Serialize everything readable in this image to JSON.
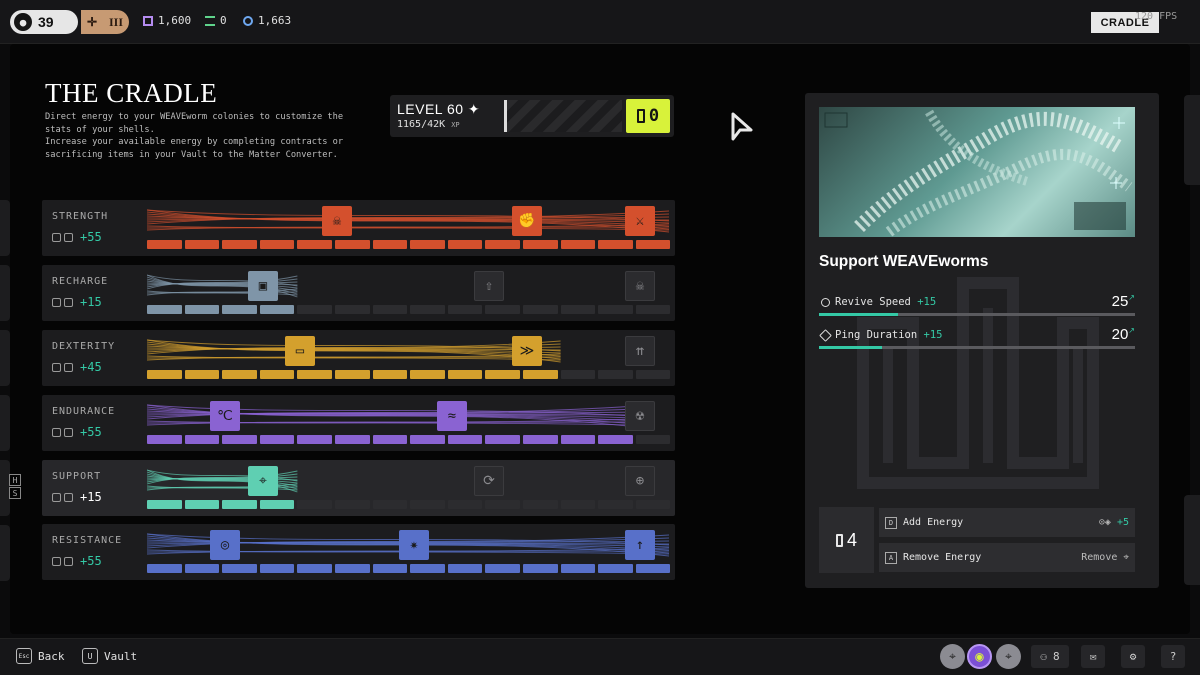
{
  "topbar": {
    "level": "39",
    "rank": "III",
    "currencies": [
      {
        "icon": "square-token-icon",
        "value": "1,600",
        "color": "#b58cf0"
      },
      {
        "icon": "stack-token-icon",
        "value": "0",
        "color": "#5fd38b"
      },
      {
        "icon": "link-token-icon",
        "value": "1,663",
        "color": "#6fa8f0"
      }
    ],
    "menu_button": "CRADLE",
    "fps": "120 FPS"
  },
  "header": {
    "title": "THE CRADLE",
    "description": [
      "Direct energy to your WEAVEworm colonies to customize the",
      "stats of your shells.",
      "Increase your available energy by completing contracts or",
      "sacrificing items in your Vault to the Matter Converter."
    ]
  },
  "level": {
    "label": "LEVEL 60 ✦",
    "xp": "1165/42K",
    "xp_unit": "XP",
    "energy": "0",
    "accent": "#d8f23a"
  },
  "stats": [
    {
      "name": "STRENGTH",
      "bonus": "+55",
      "color": "#d4502d",
      "filled": 14,
      "total": 14,
      "nodes": [
        "skull-icon",
        "fist-icon",
        "blade-icon"
      ],
      "nodes_unlocked": 3
    },
    {
      "name": "RECHARGE",
      "bonus": "+15",
      "color": "#7f95a8",
      "filled": 4,
      "total": 14,
      "nodes": [
        "camera-icon",
        "upload-icon",
        "skull-icon"
      ],
      "nodes_unlocked": 1
    },
    {
      "name": "DEXTERITY",
      "bonus": "+45",
      "color": "#d4a02d",
      "filled": 11,
      "total": 14,
      "nodes": [
        "monitor-icon",
        "speed-lines-icon",
        "up-arrows-icon"
      ],
      "nodes_unlocked": 2
    },
    {
      "name": "ENDURANCE",
      "bonus": "+55",
      "color": "#8a63d2",
      "filled": 13,
      "total": 14,
      "nodes": [
        "thermometer-clock-icon",
        "thermometer-wave-icon",
        "thermometer-skull-icon"
      ],
      "nodes_unlocked": 2
    },
    {
      "name": "SUPPORT",
      "bonus": "+15",
      "color": "#5fcfb2",
      "filled": 4,
      "total": 14,
      "nodes": [
        "crosshair-icon",
        "refresh-icon",
        "target-icon"
      ],
      "nodes_unlocked": 1
    },
    {
      "name": "RESISTANCE",
      "bonus": "+55",
      "color": "#5870c9",
      "filled": 14,
      "total": 14,
      "nodes": [
        "shield-target-icon",
        "burst-icon",
        "battery-up-icon"
      ],
      "nodes_unlocked": 3
    }
  ],
  "card": {
    "title": "Support WEAVEworms",
    "stats": [
      {
        "label": "Revive Speed",
        "bonus": "+15",
        "value": "25",
        "fill": 0.25
      },
      {
        "label": "Ping Duration",
        "bonus": "+15",
        "value": "20",
        "fill": 0.2
      }
    ],
    "energy_count": "4",
    "add_label": "Add Energy",
    "add_key": "D",
    "add_bonus": "+5",
    "remove_label": "Remove Energy",
    "remove_key": "A",
    "remove_action": "Remove"
  },
  "bottombar": {
    "back_key": "Esc",
    "back_label": "Back",
    "vault_key": "U",
    "vault_label": "Vault",
    "squad_count": "8"
  }
}
